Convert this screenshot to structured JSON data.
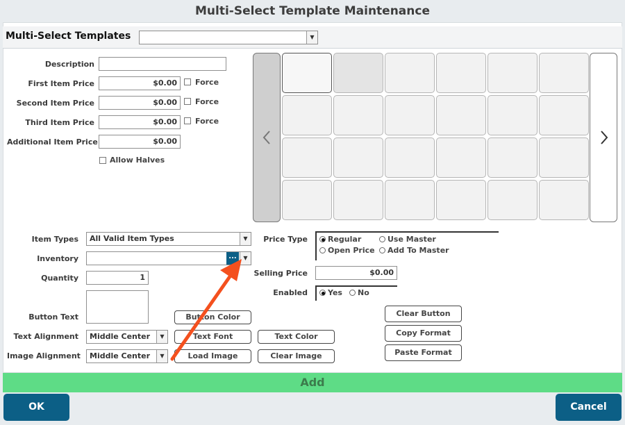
{
  "window": {
    "title": "Multi-Select Template Maintenance"
  },
  "header": {
    "templates_label": "Multi-Select Templates",
    "templates_value": ""
  },
  "form": {
    "description_label": "Description",
    "description_value": "",
    "first_price_label": "First Item Price",
    "first_price_value": "$0.00",
    "second_price_label": "Second Item Price",
    "second_price_value": "$0.00",
    "third_price_label": "Third Item Price",
    "third_price_value": "$0.00",
    "additional_price_label": "Additional Item Price",
    "additional_price_value": "$0.00",
    "force_label": "Force",
    "allow_halves_label": "Allow Halves"
  },
  "grid": {
    "rows": 4,
    "cols": 6
  },
  "details": {
    "item_types_label": "Item Types",
    "item_types_value": "All Valid Item Types",
    "inventory_label": "Inventory",
    "inventory_value": "",
    "inventory_browse": "...",
    "quantity_label": "Quantity",
    "quantity_value": "1",
    "button_text_label": "Button Text",
    "text_alignment_label": "Text Alignment",
    "text_alignment_value": "Middle Center",
    "image_alignment_label": "Image Alignment",
    "image_alignment_value": "Middle Center",
    "price_type_label": "Price Type",
    "price_type_options": [
      "Regular",
      "Use Master",
      "Open Price",
      "Add To Master"
    ],
    "price_type_selected": "Regular",
    "selling_price_label": "Selling Price",
    "selling_price_value": "$0.00",
    "enabled_label": "Enabled",
    "enabled_yes": "Yes",
    "enabled_no": "No"
  },
  "buttons": {
    "button_color": "Button Color",
    "text_font": "Text Font",
    "text_color": "Text Color",
    "load_image": "Load Image",
    "clear_image": "Clear Image",
    "clear_button": "Clear Button",
    "copy_format": "Copy Format",
    "paste_format": "Paste Format",
    "add": "Add",
    "ok": "OK",
    "cancel": "Cancel"
  },
  "colors": {
    "accent": "#0c5f86",
    "add_bar": "#5edc86",
    "annotation_arrow": "#f4501e"
  }
}
